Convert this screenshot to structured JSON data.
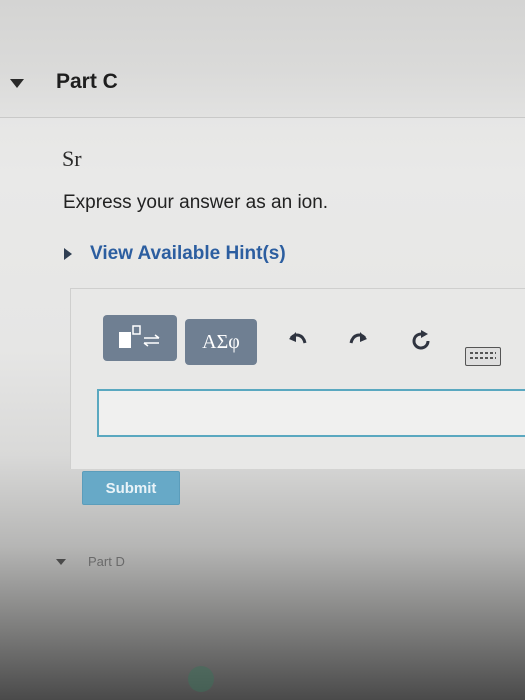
{
  "part_c": {
    "title": "Part C",
    "element": "Sr",
    "instruction": "Express your answer as an ion.",
    "hint_link": "View Available Hint(s)"
  },
  "toolbar": {
    "greek_symbols_label": "ΑΣφ",
    "undo_icon": "undo-arrow",
    "redo_icon": "redo-arrow",
    "reset_icon": "circular-arrow",
    "keyboard_icon": "keyboard"
  },
  "answer": {
    "value": "",
    "placeholder": ""
  },
  "submit_label": "Submit",
  "part_d": {
    "title": "Part D"
  },
  "colors": {
    "hint_link": "#2c5ea0",
    "toolbar_button": "#6f7f92",
    "submit_button": "#67a9c7",
    "input_border": "#5aa8c0"
  }
}
